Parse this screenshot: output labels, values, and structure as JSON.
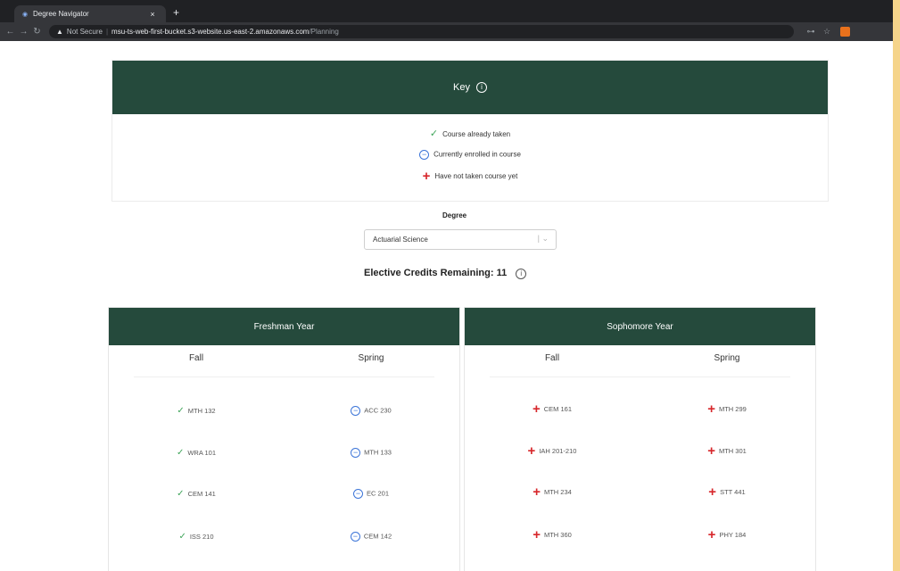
{
  "browser": {
    "tab_title": "Degree Navigator",
    "tab_close": "×",
    "new_tab": "+",
    "security": "Not Secure",
    "url_host": "msu-ts-web-first-bucket.s3-website.us-east-2.amazonaws.com",
    "url_path": "/Planning"
  },
  "key": {
    "title": "Key",
    "items": [
      {
        "label": "Course already taken",
        "status": "taken"
      },
      {
        "label": "Currently enrolled in course",
        "status": "enrolled"
      },
      {
        "label": "Have not taken course yet",
        "status": "not-taken"
      }
    ]
  },
  "degree": {
    "label": "Degree",
    "selected": "Actuarial Science"
  },
  "elective": {
    "label": "Elective Credits Remaining:",
    "value": "11"
  },
  "years": [
    {
      "title": "Freshman Year",
      "fall_label": "Fall",
      "spring_label": "Spring",
      "fall": [
        {
          "code": "MTH 132",
          "status": "taken"
        },
        {
          "code": "WRA 101",
          "status": "taken"
        },
        {
          "code": "CEM 141",
          "status": "taken"
        },
        {
          "code": "ISS 210",
          "status": "taken"
        }
      ],
      "spring": [
        {
          "code": "ACC 230",
          "status": "enrolled"
        },
        {
          "code": "MTH 133",
          "status": "enrolled"
        },
        {
          "code": "EC 201",
          "status": "enrolled"
        },
        {
          "code": "CEM 142",
          "status": "enrolled"
        }
      ]
    },
    {
      "title": "Sophomore Year",
      "fall_label": "Fall",
      "spring_label": "Spring",
      "fall": [
        {
          "code": "CEM 161",
          "status": "not-taken"
        },
        {
          "code": "IAH 201-210",
          "status": "not-taken"
        },
        {
          "code": "MTH 234",
          "status": "not-taken"
        },
        {
          "code": "MTH 360",
          "status": "not-taken"
        }
      ],
      "spring": [
        {
          "code": "MTH 299",
          "status": "not-taken"
        },
        {
          "code": "MTH 301",
          "status": "not-taken"
        },
        {
          "code": "STT 441",
          "status": "not-taken"
        },
        {
          "code": "PHY 184",
          "status": "not-taken"
        }
      ]
    }
  ],
  "colors": {
    "header_green": "#254a3c",
    "taken": "#3fa55a",
    "enrolled": "#3b74d8",
    "not_taken": "#d7272b"
  }
}
